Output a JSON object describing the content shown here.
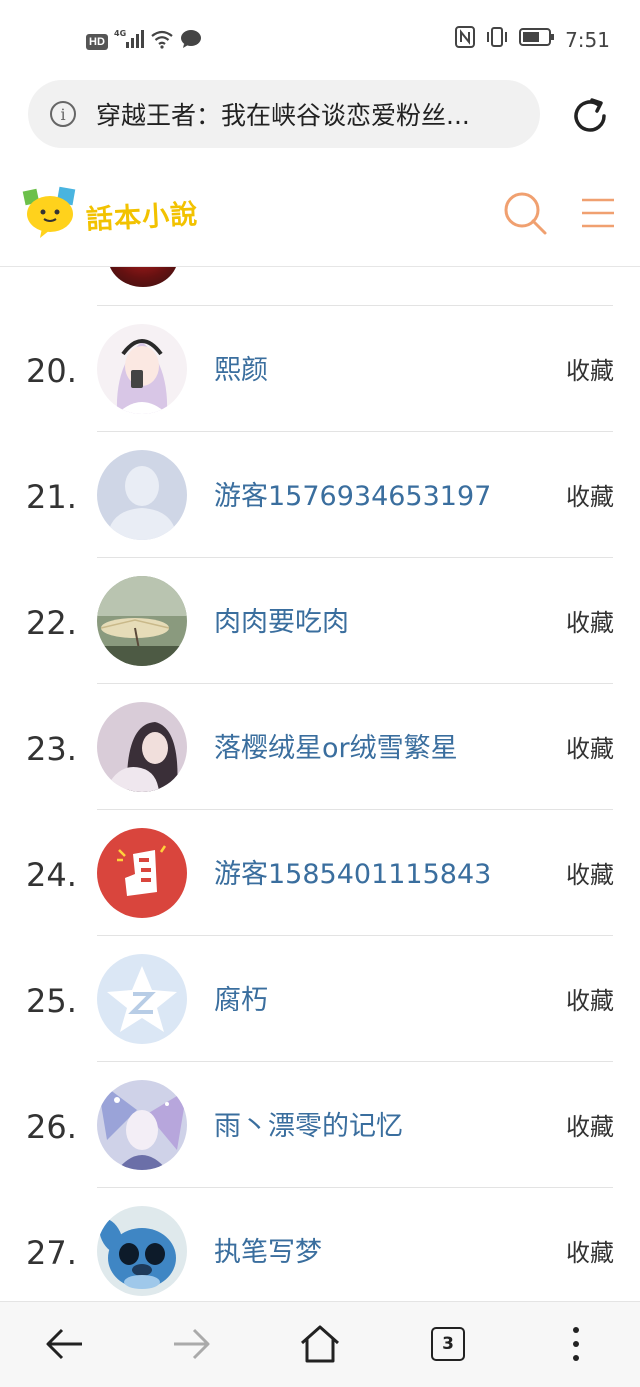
{
  "status_bar": {
    "hd": "HD",
    "network": "4G",
    "time": "7:51"
  },
  "browser": {
    "page_title": "穿越王者：我在峡谷谈恋爱粉丝..."
  },
  "site": {
    "logo_text": "話本小說"
  },
  "list": {
    "action_label": "收藏",
    "rows": [
      {
        "rank": "20.",
        "name": "熙颜",
        "avatar": "anime-girl-avatar"
      },
      {
        "rank": "21.",
        "name": "游客1576934653197",
        "avatar": "default-user-avatar"
      },
      {
        "rank": "22.",
        "name": "肉肉要吃肉",
        "avatar": "umbrella-photo-avatar"
      },
      {
        "rank": "23.",
        "name": "落樱绒星or绒雪繁星",
        "avatar": "girl-photo-avatar"
      },
      {
        "rank": "24.",
        "name": "游客1585401115843",
        "avatar": "red-app-avatar"
      },
      {
        "rank": "25.",
        "name": "腐朽",
        "avatar": "qzone-star-avatar"
      },
      {
        "rank": "26.",
        "name": "雨丶漂零的记忆",
        "avatar": "anime-art-avatar"
      },
      {
        "rank": "27.",
        "name": "执笔写梦",
        "avatar": "stitch-cartoon-avatar"
      }
    ]
  },
  "bottom_nav": {
    "tab_count": "3"
  },
  "colors": {
    "accent_orange": "#f0a070",
    "username_blue": "#3a6e9e",
    "logo_yellow": "#f2c200"
  }
}
